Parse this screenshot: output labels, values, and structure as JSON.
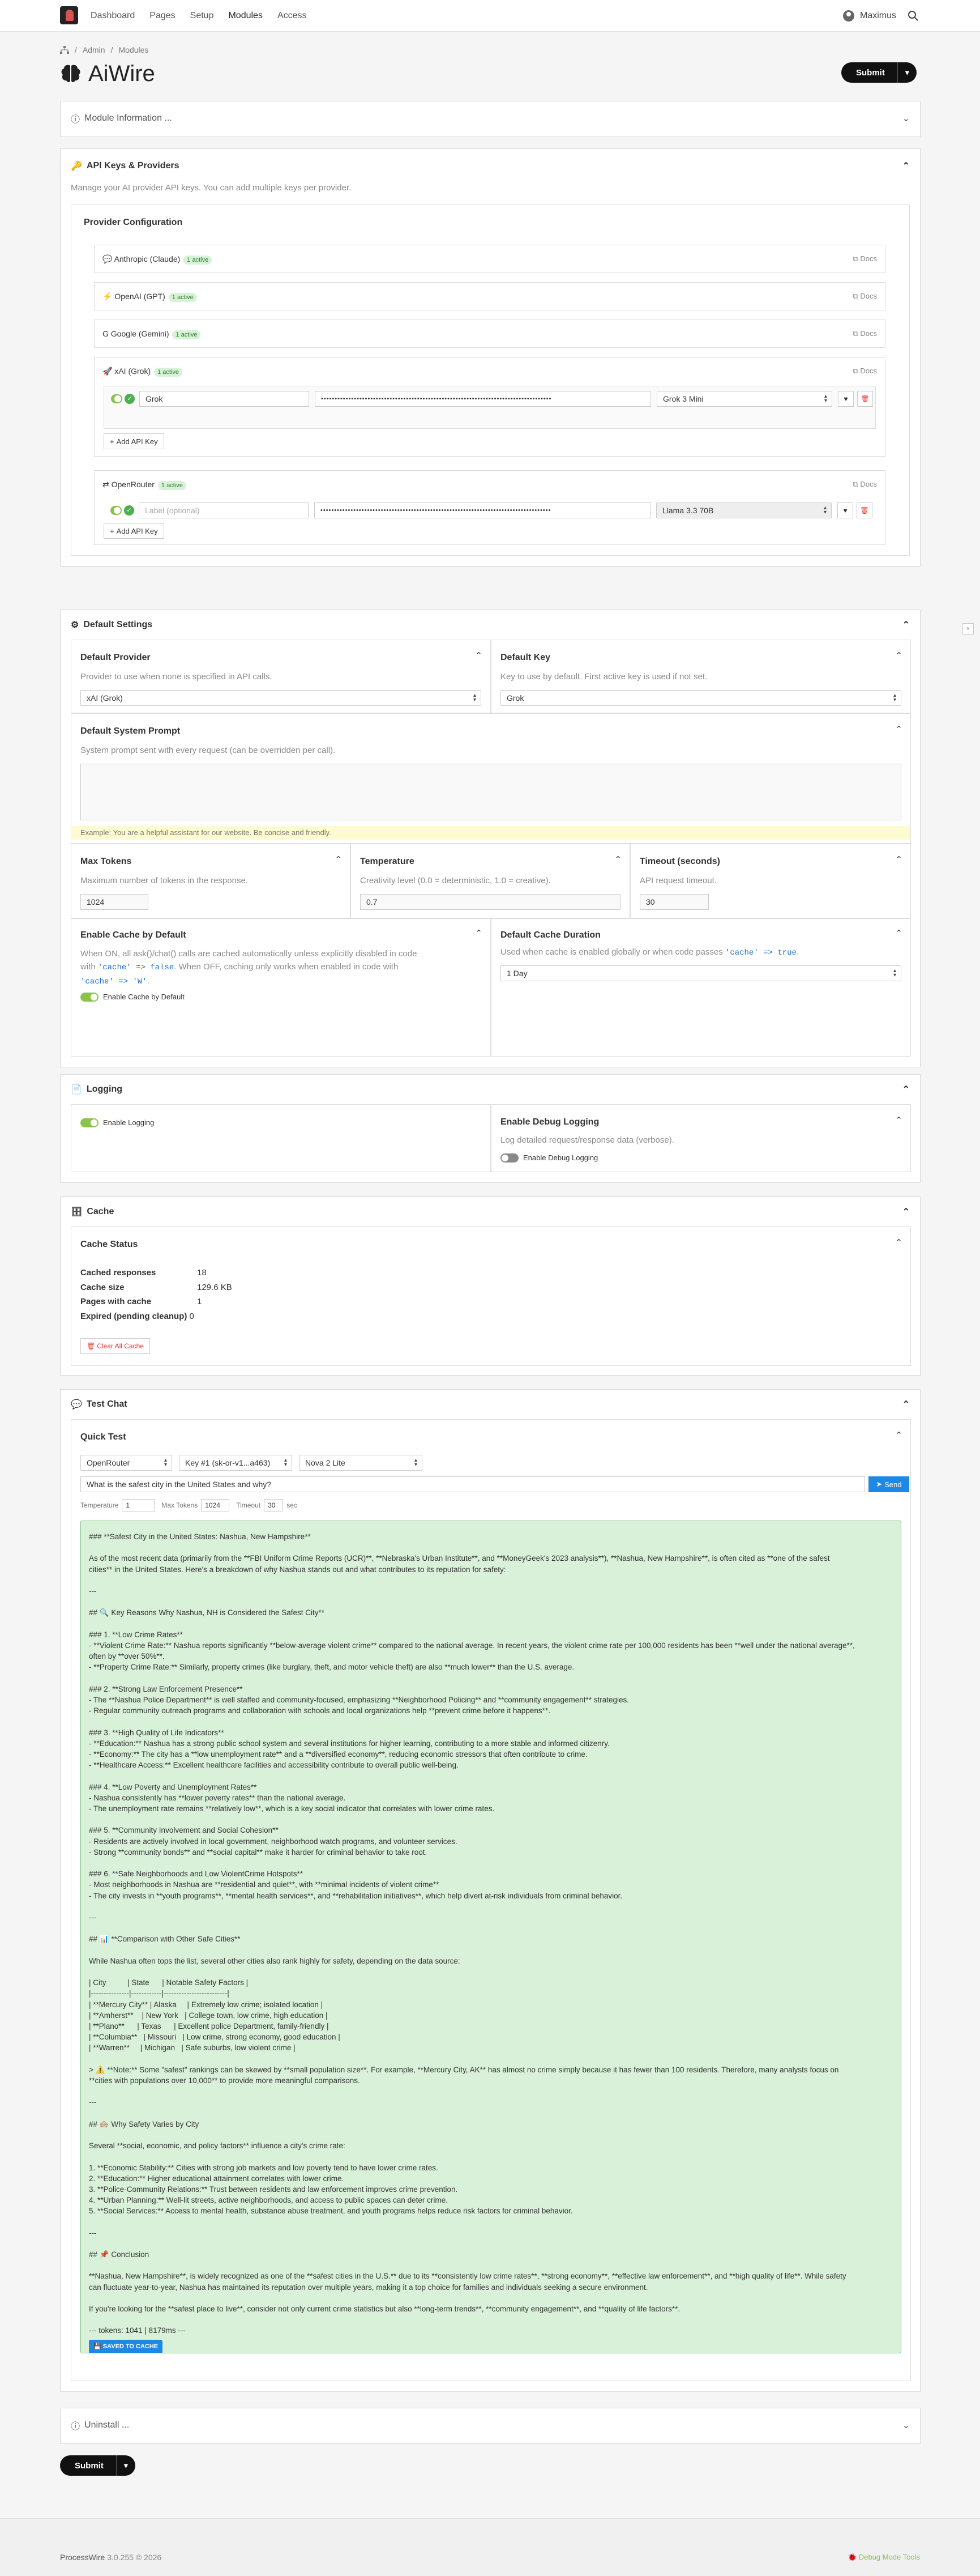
{
  "nav": {
    "items": [
      "Dashboard",
      "Pages",
      "Setup",
      "Modules",
      "Access"
    ],
    "user": "Maximus"
  },
  "breadcrumb": [
    "Admin",
    "Modules"
  ],
  "page": {
    "title": "AiWire",
    "submit": "Submit"
  },
  "module_info": {
    "title": "Module Information ..."
  },
  "api": {
    "title": "API Keys & Providers",
    "desc": "Manage your AI provider API keys. You can add multiple keys per provider.",
    "config_title": "Provider Configuration",
    "docs": "Docs",
    "add_key": "Add API Key",
    "providers": [
      {
        "name": "Anthropic (Claude)",
        "badge": "1 active"
      },
      {
        "name": "OpenAI (GPT)",
        "badge": "1 active"
      },
      {
        "name": "Google (Gemini)",
        "badge": "1 active"
      },
      {
        "name": "xAI (Grok)",
        "badge": "1 active"
      },
      {
        "name": "OpenRouter",
        "badge": "1 active"
      }
    ],
    "xai_key": {
      "label": "Grok",
      "key": "••••••••••••••••••••••••••••••••••••••••••••••••••••••••••••••••••••••••••••••••••••",
      "model": "Grok 3 Mini"
    },
    "openrouter_key": {
      "placeholder": "Label (optional)",
      "key": "••••••••••••••••••••••••••••••••••••••••••••••••••••••••••••••••••••••••••••••••••••",
      "model": "Llama 3.3 70B"
    }
  },
  "defaults": {
    "title": "Default Settings",
    "provider": {
      "title": "Default Provider",
      "desc": "Provider to use when none is specified in API calls.",
      "value": "xAI (Grok)"
    },
    "key": {
      "title": "Default Key",
      "desc": "Key to use by default. First active key is used if not set.",
      "value": "Grok"
    },
    "prompt": {
      "title": "Default System Prompt",
      "desc": "System prompt sent with every request (can be overridden per call).",
      "example": "Example: You are a helpful assistant for our website. Be concise and friendly."
    },
    "max_tokens": {
      "title": "Max Tokens",
      "desc": "Maximum number of tokens in the response.",
      "value": "1024"
    },
    "temperature": {
      "title": "Temperature",
      "desc": "Creativity level (0.0 = deterministic, 1.0 = creative).",
      "value": "0.7"
    },
    "timeout": {
      "title": "Timeout (seconds)",
      "desc": "API request timeout.",
      "value": "30"
    },
    "cache": {
      "title": "Enable Cache by Default",
      "desc1": "When ON, all ask()/chat() calls are cached automatically unless explicitly disabled in code",
      "desc2a": "with ",
      "code1": "'cache' => false",
      "desc2b": ". When OFF, caching only works when enabled in code with",
      "code2": "'cache' => 'W'",
      "desc3": ".",
      "toggle": "Enable Cache by Default"
    },
    "cache_duration": {
      "title": "Default Cache Duration",
      "desc": "Used when cache is enabled globally or when code passes ",
      "code": "'cache' => true",
      "desc_end": ".",
      "value": "1 Day"
    }
  },
  "logging": {
    "title": "Logging",
    "enable": "Enable Logging",
    "debug_title": "Enable Debug Logging",
    "debug_desc": "Log detailed request/response data (verbose).",
    "debug_toggle": "Enable Debug Logging"
  },
  "cache": {
    "title": "Cache",
    "status_title": "Cache Status",
    "rows": [
      {
        "k": "Cached responses",
        "v": "18"
      },
      {
        "k": "Cache size",
        "v": "129.6 KB"
      },
      {
        "k": "Pages with cache",
        "v": "1"
      },
      {
        "k": "Expired (pending cleanup)",
        "v": "0"
      }
    ],
    "clear": "Clear All Cache"
  },
  "test": {
    "title": "Test Chat",
    "quick": "Quick Test",
    "provider": "OpenRouter",
    "key": "Key #1 (sk-or-v1...a463)",
    "model": "Nova 2 Lite",
    "question": "What is the safest city in the United States and why?",
    "send": "Send",
    "temp_label": "Temperature",
    "temp": "1",
    "maxtok_label": "Max Tokens",
    "maxtok": "1024",
    "timeout_label": "Timeout",
    "timeout": "30",
    "sec": "sec",
    "saved": "SAVED TO CACHE",
    "response": [
      "### **Safest City in the United States: Nashua, New Hampshire**",
      "",
      "As of the most recent data (primarily from the **FBI Uniform Crime Reports (UCR)**, **Nebraska's Urban Institute**, and **MoneyGeek's 2023 analysis**), **Nashua, New Hampshire**, is often cited as **one of the safest",
      "cities** in the United States. Here's a breakdown of why Nashua stands out and what contributes to its reputation for safety:",
      "",
      "---",
      "",
      "## 🔍 Key Reasons Why Nashua, NH is Considered the Safest City**",
      "",
      "### 1. **Low Crime Rates**",
      "- **Violent Crime Rate:** Nashua reports significantly **below-average violent crime** compared to the national average. In recent years, the violent crime rate per 100,000 residents has been **well under the national average**,",
      "often by **over 50%**.",
      "- **Property Crime Rate:** Similarly, property crimes (like burglary, theft, and motor vehicle theft) are also **much lower** than the U.S. average.",
      "",
      "### 2. **Strong Law Enforcement Presence**",
      "- The **Nashua Police Department** is well staffed and community-focused, emphasizing **Neighborhood Policing** and **community engagement** strategies.",
      "- Regular community outreach programs and collaboration with schools and local organizations help **prevent crime before it happens**.",
      "",
      "### 3. **High Quality of Life Indicators**",
      "- **Education:** Nashua has a strong public school system and several institutions for higher learning, contributing to a more stable and informed citizenry.",
      "- **Economy:** The city has a **low unemployment rate** and a **diversified economy**, reducing economic stressors that often contribute to crime.",
      "- **Healthcare Access:** Excellent healthcare facilities and accessibility contribute to overall public well-being.",
      "",
      "### 4. **Low Poverty and Unemployment Rates**",
      "- Nashua consistently has **lower poverty rates** than the national average.",
      "- The unemployment rate remains **relatively low**, which is a key social indicator that correlates with lower crime rates.",
      "",
      "### 5. **Community Involvement and Social Cohesion**",
      "- Residents are actively involved in local government, neighborhood watch programs, and volunteer services.",
      "- Strong **community bonds** and **social capital** make it harder for criminal behavior to take root.",
      "",
      "### 6. **Safe Neighborhoods and Low ViolentCrime Hotspots**",
      "- Most neighborhoods in Nashua are **residential and quiet**, with **minimal incidents of violent crime**",
      "- The city invests in **youth programs**, **mental health services**, and **rehabilitation initiatives**, which help divert at-risk individuals from criminal behavior.",
      "",
      "---",
      "",
      "## 📊 **Comparison with Other Safe Cities**",
      "",
      "While Nashua often tops the list, several other cities also rank highly for safety, depending on the data source:",
      "",
      "| City          | State      | Notable Safety Factors |",
      "|---------------|------------|-------------------------|",
      "| **Mercury City** | Alaska     | Extremely low crime; isolated location |",
      "| **Amherst**    | New York   | College town, low crime, high education |",
      "| **Plano**      | Texas      | Excellent police Department, family-friendly |",
      "| **Columbia**   | Missouri   | Low crime, strong economy, good education |",
      "| **Warren**     | Michigan   | Safe suburbs, low violent crime |",
      "",
      "> ⚠️ **Note:** Some \"safest\" rankings can be skewed by **small population size**. For example, **Mercury City, AK** has almost no crime simply because it has fewer than 100 residents. Therefore, many analysts focus on",
      "**cities with populations over 10,000** to provide more meaningful comparisons.",
      "",
      "---",
      "",
      "## 🏘️ Why Safety Varies by City",
      "",
      "Several **social, economic, and policy factors** influence a city's crime rate:",
      "",
      "1. **Economic Stability:** Cities with strong job markets and low poverty tend to have lower crime rates.",
      "2. **Education:** Higher educational attainment correlates with lower crime.",
      "3. **Police-Community Relations:** Trust between residents and law enforcement improves crime prevention.",
      "4. **Urban Planning:** Well-lit streets, active neighborhoods, and access to public spaces can deter crime.",
      "5. **Social Services:** Access to mental health, substance abuse treatment, and youth programs helps reduce risk factors for criminal behavior.",
      "",
      "---",
      "",
      "## 📌 Conclusion",
      "",
      "**Nashua, New Hampshire**, is widely recognized as one of the **safest cities in the U.S.** due to its **consistently low crime rates**, **strong economy**, **effective law enforcement**, and **high quality of life**. While safety",
      "can fluctuate year-to-year, Nashua has maintained its reputation over multiple years, making it a top choice for families and individuals seeking a secure environment.",
      "",
      "If you're looking for the **safest place to live**, consider not only current crime statistics but also **long-term trends**, **community engagement**, and **quality of life factors**.",
      "",
      "--- tokens: 1041 | 8179ms ---"
    ]
  },
  "uninstall": {
    "title": "Uninstall ..."
  },
  "footer": {
    "brand": "ProcessWire",
    "version": "3.0.255 © 2026",
    "debug": "Debug Mode Tools"
  }
}
